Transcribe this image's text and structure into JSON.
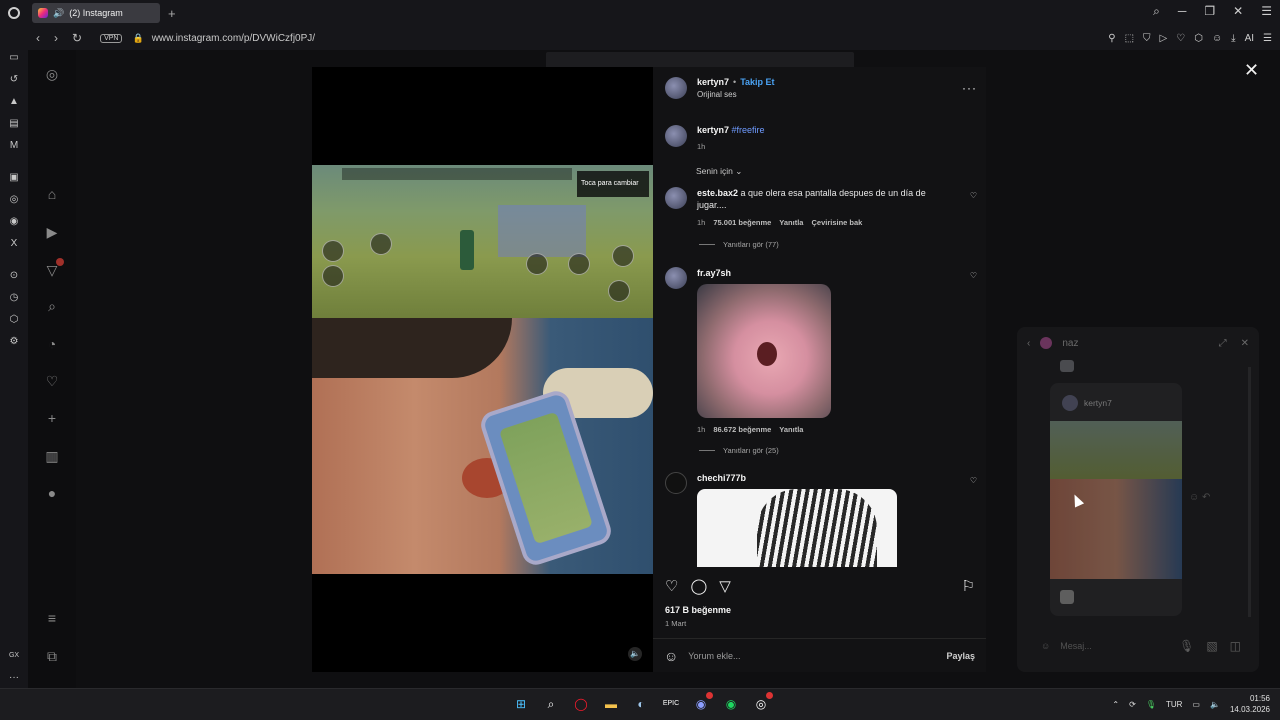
{
  "browser": {
    "tab_title": "(2) Instagram",
    "new_tab": "+",
    "url": "www.instagram.com/p/DVWiCzfj0PJ/",
    "vpn_label": "VPN",
    "ai_label": "AI"
  },
  "modal": {
    "close": "✕",
    "author": "kertyn7",
    "separator": "•",
    "follow_label": "Takip Et",
    "audio": "Orijinal ses",
    "more": "···",
    "caption_user": "kertyn7",
    "caption_tag": "#freefire",
    "caption_time": "1h",
    "sort_label": "Senin için",
    "game_overlay_text": "Toca para cambiar",
    "comments": [
      {
        "user": "este.bax2",
        "text": "a que olera esa pantalla despues de un día de jugar....",
        "time": "1h",
        "likes": "75.001 beğenme",
        "reply": "Yanıtla",
        "translate": "Çevirisine bak",
        "replies": "Yanıtları gör (77)"
      },
      {
        "user": "fr.ay7sh",
        "time": "1h",
        "likes": "86.672 beğenme",
        "reply": "Yanıtla",
        "replies": "Yanıtları gör (25)"
      },
      {
        "user": "chechi777b"
      }
    ],
    "likes_total": "617 B beğenme",
    "date": "1 Mart",
    "comment_placeholder": "Yorum ekle...",
    "share_label": "Paylaş"
  },
  "dm": {
    "name": "naz",
    "shared_user": "kertyn7",
    "input_placeholder": "Mesaj..."
  },
  "opera_sidebar": {
    "gx_label": "GX",
    "more": "···"
  },
  "taskbar": {
    "lang": "TUR",
    "time": "01:56",
    "date": "14.03.2026",
    "discord_badge": "9+"
  }
}
